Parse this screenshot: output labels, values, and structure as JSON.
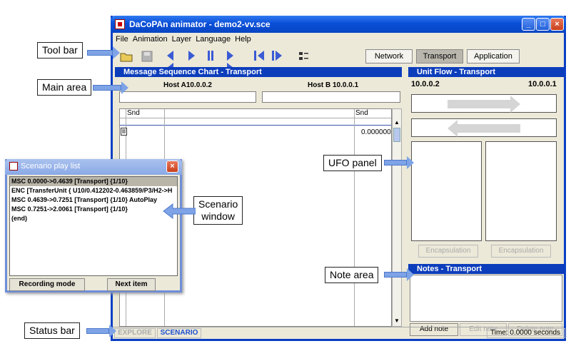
{
  "window": {
    "title": "DaCoPAn animator - demo2-vv.sce",
    "menu": [
      "File",
      "Animation",
      "Layer",
      "Language",
      "Help"
    ],
    "view_buttons": [
      "Network",
      "Transport",
      "Application"
    ],
    "active_view": "Transport"
  },
  "msc": {
    "header": "Message Sequence Chart - Transport",
    "host_a": "Host A10.0.0.2",
    "host_b": "Host B 10.0.0.1",
    "col_left": "Snd",
    "col_right": "Snd",
    "time_value": "0.000000"
  },
  "ufo": {
    "header": "Unit Flow - Transport",
    "left_addr": "10.0.0.2",
    "right_addr": "10.0.0.1",
    "encap_left": "Encapsulation",
    "encap_right": "Encapsulation"
  },
  "notes": {
    "header": "Notes - Transport",
    "add": "Add note",
    "edit": "Edit note",
    "delete": "Delete note"
  },
  "status": {
    "explore": "EXPLORE",
    "scenario": "SCENARIO",
    "time": "Time: 0.0000 seconds"
  },
  "scenario_window": {
    "title": "Scenario play list",
    "items": [
      "MSC 0.0000->0.4639 [Transport] {1/10}",
      "ENC [TransferUnit { U10/0.412202-0.463859/P3/H2->H",
      "MSC 0.4639->0.7251 [Transport] {1/10} AutoPlay",
      "MSC 0.7251->2.0061 [Transport] {1/10}",
      "(end)"
    ],
    "selected_index": 0,
    "recording_button": "Recording mode",
    "next_button": "Next item"
  },
  "callouts": {
    "toolbar": "Tool bar",
    "main_area": "Main area",
    "ufo_panel": "UFO panel",
    "scenario_window_1": "Scenario",
    "scenario_window_2": "window",
    "note_area": "Note area",
    "status_bar": "Status bar"
  }
}
